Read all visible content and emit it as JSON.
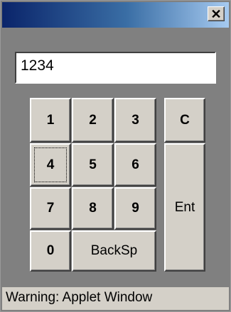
{
  "window": {
    "title": "",
    "close_glyph": "✕"
  },
  "display": {
    "value": "1234"
  },
  "keypad": {
    "k1": "1",
    "k2": "2",
    "k3": "3",
    "clear": "C",
    "k4": "4",
    "k5": "5",
    "k6": "6",
    "k7": "7",
    "k8": "8",
    "k9": "9",
    "enter": "Ent",
    "k0": "0",
    "backspace": "BackSp"
  },
  "status": {
    "text": "Warning: Applet Window"
  }
}
